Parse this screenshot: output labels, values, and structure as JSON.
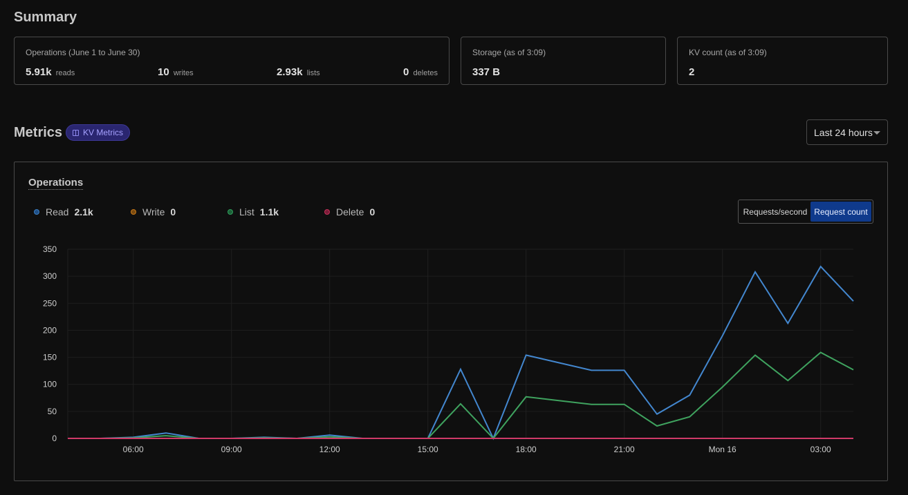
{
  "summary": {
    "title": "Summary",
    "operations": {
      "label": "Operations",
      "range": "(June 1 to June 30)",
      "stats": [
        {
          "value": "5.91k",
          "unit": "reads"
        },
        {
          "value": "10",
          "unit": "writes"
        },
        {
          "value": "2.93k",
          "unit": "lists"
        },
        {
          "value": "0",
          "unit": "deletes"
        }
      ]
    },
    "storage": {
      "label": "Storage",
      "sub": "(as of 3:09)",
      "value": "337 B"
    },
    "kv_count": {
      "label": "KV count",
      "sub": "(as of 3:09)",
      "value": "2"
    }
  },
  "metrics": {
    "title": "Metrics",
    "badge": "KV Metrics",
    "badge_icon": "book-icon",
    "range": "Last 24 hours"
  },
  "panel": {
    "title": "Operations",
    "legend": [
      {
        "name": "Read",
        "value": "2.1k",
        "color": "#3b7fc6"
      },
      {
        "name": "Write",
        "value": "0",
        "color": "#c87918"
      },
      {
        "name": "List",
        "value": "1.1k",
        "color": "#2f9e5b"
      },
      {
        "name": "Delete",
        "value": "0",
        "color": "#c5305a"
      }
    ],
    "toggle": {
      "option_a": "Requests/second",
      "option_b": "Request count",
      "selected": "Request count"
    }
  },
  "chart_data": {
    "type": "line",
    "x_ticks": [
      "06:00",
      "09:00",
      "12:00",
      "15:00",
      "18:00",
      "21:00",
      "Mon 16",
      "03:00"
    ],
    "x": [
      "04:00",
      "05:00",
      "06:00",
      "07:00",
      "08:00",
      "09:00",
      "10:00",
      "11:00",
      "12:00",
      "13:00",
      "14:00",
      "15:00",
      "16:00",
      "17:00",
      "18:00",
      "19:00",
      "20:00",
      "21:00",
      "22:00",
      "23:00",
      "00:00",
      "01:00",
      "02:00",
      "03:00",
      "04:00"
    ],
    "ylim": [
      0,
      350
    ],
    "y_ticks": [
      0,
      50,
      100,
      150,
      200,
      250,
      300,
      350
    ],
    "grid": true,
    "series": [
      {
        "name": "Read",
        "color": "#4387cf",
        "values": [
          0,
          0,
          2,
          10,
          0,
          0,
          2,
          0,
          6,
          0,
          0,
          0,
          128,
          0,
          154,
          140,
          126,
          126,
          45,
          80,
          190,
          308,
          213,
          318,
          254
        ]
      },
      {
        "name": "List",
        "color": "#3fa35f",
        "values": [
          0,
          0,
          1,
          5,
          0,
          0,
          1,
          0,
          3,
          0,
          0,
          0,
          64,
          0,
          77,
          70,
          63,
          63,
          23,
          40,
          95,
          154,
          107,
          159,
          127
        ]
      },
      {
        "name": "Write",
        "color": "#c87918",
        "values": [
          0,
          0,
          0,
          0,
          0,
          0,
          0,
          0,
          0,
          0,
          0,
          0,
          0,
          0,
          0,
          0,
          0,
          0,
          0,
          0,
          0,
          0,
          0,
          0,
          0
        ]
      },
      {
        "name": "Delete",
        "color": "#d03a68",
        "values": [
          0,
          0,
          0,
          0,
          0,
          0,
          0,
          0,
          0,
          0,
          0,
          0,
          0,
          0,
          0,
          0,
          0,
          0,
          0,
          0,
          0,
          0,
          0,
          0,
          0
        ]
      }
    ]
  }
}
